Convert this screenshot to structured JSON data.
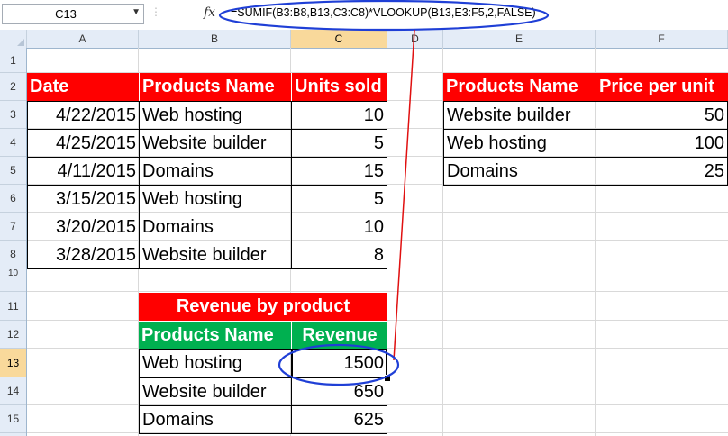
{
  "name_box": "C13",
  "formula": "=SUMIF(B3:B8,B13,C3:C8)*VLOOKUP(B13,E3:F5,2,FALSE)",
  "columns": [
    "A",
    "B",
    "C",
    "D",
    "E",
    "F"
  ],
  "rows": [
    "1",
    "2",
    "3",
    "4",
    "5",
    "6",
    "7",
    "8",
    "10",
    "11",
    "12",
    "13",
    "14",
    "15"
  ],
  "sales": {
    "headers": [
      "Date",
      "Products Name",
      "Units sold"
    ],
    "rows": [
      {
        "date": "4/22/2015",
        "product": "Web hosting",
        "units": "10"
      },
      {
        "date": "4/25/2015",
        "product": "Website builder",
        "units": "5"
      },
      {
        "date": "4/11/2015",
        "product": "Domains",
        "units": "15"
      },
      {
        "date": "3/15/2015",
        "product": "Web hosting",
        "units": "5"
      },
      {
        "date": "3/20/2015",
        "product": "Domains",
        "units": "10"
      },
      {
        "date": "3/28/2015",
        "product": "Website builder",
        "units": "8"
      }
    ]
  },
  "prices": {
    "headers": [
      "Products Name",
      "Price per unit"
    ],
    "rows": [
      {
        "product": "Website builder",
        "price": "50"
      },
      {
        "product": "Web hosting",
        "price": "100"
      },
      {
        "product": "Domains",
        "price": "25"
      }
    ]
  },
  "revenue": {
    "title": "Revenue by product",
    "headers": [
      "Products Name",
      "Revenue"
    ],
    "rows": [
      {
        "product": "Web hosting",
        "value": "1500"
      },
      {
        "product": "Website builder",
        "value": "650"
      },
      {
        "product": "Domains",
        "value": "625"
      }
    ]
  },
  "colors": {
    "header_red": "#ff0000",
    "header_green": "#00b050",
    "annotation_blue": "#1f3fd6",
    "annotation_red": "#e01010",
    "selected_header": "#f9d99b"
  }
}
